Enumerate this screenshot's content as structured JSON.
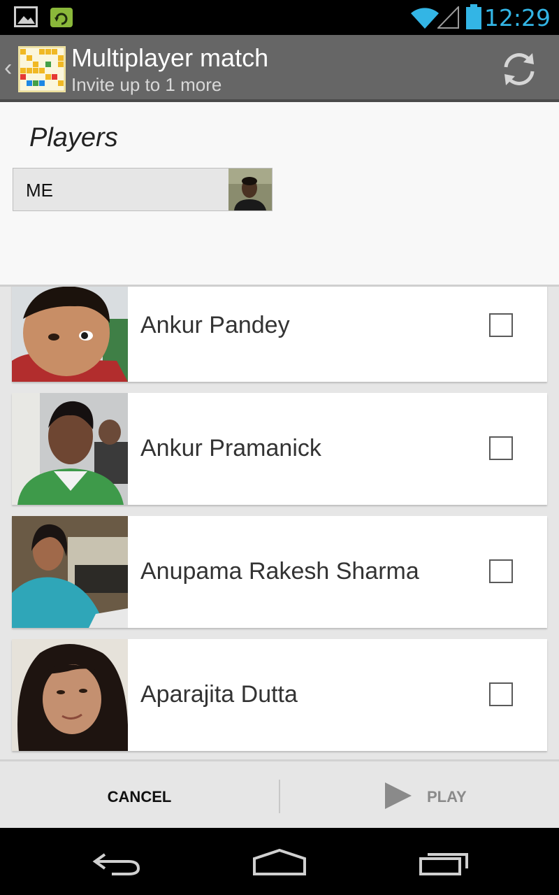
{
  "status_bar": {
    "time": "12:29",
    "icons": [
      "gallery-notification-icon",
      "app-update-notification-icon",
      "wifi-icon",
      "signal-icon",
      "battery-icon"
    ],
    "accent": "#33b5e5"
  },
  "action_bar": {
    "title": "Multiplayer match",
    "subtitle": "Invite up to 1 more",
    "refresh_icon": "refresh-icon"
  },
  "players": {
    "heading": "Players",
    "me_label": "ME"
  },
  "friends": [
    {
      "name": "Ankur Pandey",
      "checked": false
    },
    {
      "name": "Ankur Pramanick",
      "checked": false
    },
    {
      "name": "Anupama Rakesh Sharma",
      "checked": false
    },
    {
      "name": "Aparajita Dutta",
      "checked": false
    }
  ],
  "buttons": {
    "cancel": "CANCEL",
    "play": "PLAY"
  },
  "nav": {
    "icons": [
      "back-icon",
      "home-icon",
      "recents-icon"
    ]
  }
}
